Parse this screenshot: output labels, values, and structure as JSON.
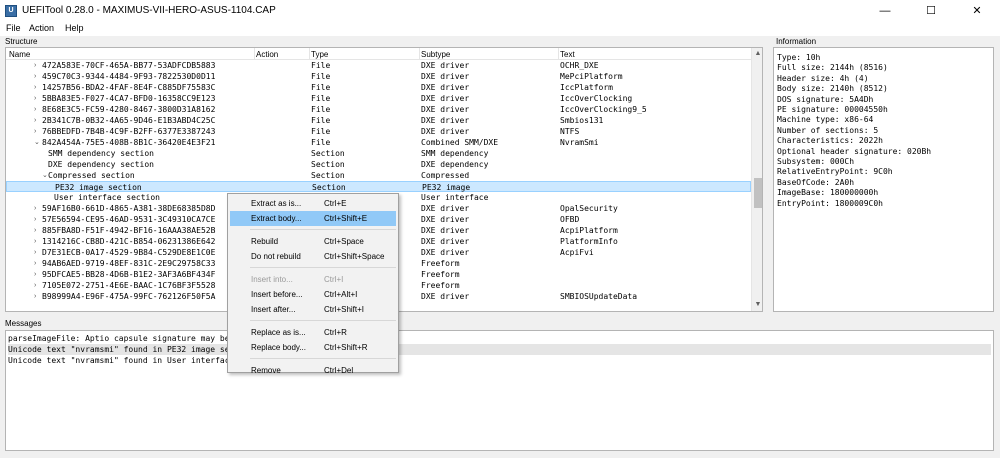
{
  "window": {
    "title": "UEFITool 0.28.0 - MAXIMUS-VII-HERO-ASUS-1104.CAP",
    "icon": "app-icon",
    "minimize": "—",
    "maximize": "☐",
    "close": "✕"
  },
  "menu": [
    "File",
    "Action",
    "Help"
  ],
  "structure": {
    "label": "Structure",
    "columns": [
      "Name",
      "Action",
      "Type",
      "Subtype",
      "Text"
    ],
    "rows": [
      {
        "arrow": "›",
        "name": "472A583E-70CF-465A-BB77-53ADFCDB5883",
        "action": "",
        "type": "File",
        "subtype": "DXE driver",
        "text": "OCHR_DXE"
      },
      {
        "arrow": "›",
        "name": "459C70C3-9344-4484-9F93-7822530D0D11",
        "action": "",
        "type": "File",
        "subtype": "DXE driver",
        "text": "MePciPlatform"
      },
      {
        "arrow": "›",
        "name": "14257B56-BDA2-4FAF-8E4F-C885DF75583C",
        "action": "",
        "type": "File",
        "subtype": "DXE driver",
        "text": "IccPlatform"
      },
      {
        "arrow": "›",
        "name": "5BBA83E5-F027-4CA7-BFD0-16358CC9E123",
        "action": "",
        "type": "File",
        "subtype": "DXE driver",
        "text": "IccOverClocking"
      },
      {
        "arrow": "›",
        "name": "8E68E3C5-FC59-4280-8467-3800D31A8162",
        "action": "",
        "type": "File",
        "subtype": "DXE driver",
        "text": "IccOverClocking9_5"
      },
      {
        "arrow": "›",
        "name": "2B341C7B-0B32-4A65-9D46-E1B3ABD4C25C",
        "action": "",
        "type": "File",
        "subtype": "DXE driver",
        "text": "Smbios131"
      },
      {
        "arrow": "›",
        "name": "76BBEDFD-7B4B-4C9F-B2FF-6377E3387243",
        "action": "",
        "type": "File",
        "subtype": "DXE driver",
        "text": "NTFS"
      },
      {
        "arrow": "⌄",
        "name": "842A454A-75E5-408B-8B1C-36420E4E3F21",
        "action": "",
        "type": "File",
        "subtype": "Combined SMM/DXE",
        "text": "NvramSmi"
      },
      {
        "arrow": "",
        "name": "SMM dependency section",
        "action": "",
        "type": "Section",
        "subtype": "SMM dependency",
        "text": ""
      },
      {
        "arrow": "",
        "name": "DXE dependency section",
        "action": "",
        "type": "Section",
        "subtype": "DXE dependency",
        "text": ""
      },
      {
        "arrow": "⌄",
        "name": "Compressed section",
        "action": "",
        "type": "Section",
        "subtype": "Compressed",
        "text": ""
      },
      {
        "arrow": "",
        "name": "PE32 image section",
        "action": "",
        "type": "Section",
        "subtype": "PE32 image",
        "text": ""
      },
      {
        "arrow": "",
        "name": "User interface section",
        "action": "",
        "type": "Section",
        "subtype": "User interface",
        "text": ""
      },
      {
        "arrow": "›",
        "name": "59AF16B0-661D-4865-A381-38DE68385D8D",
        "action": "",
        "type": "File",
        "subtype": "DXE driver",
        "text": "OpalSecurity"
      },
      {
        "arrow": "›",
        "name": "57E56594-CE95-46AD-9531-3C49310CA7CE",
        "action": "",
        "type": "File",
        "subtype": "DXE driver",
        "text": "OFBD"
      },
      {
        "arrow": "›",
        "name": "885FBA8D-F51F-4942-BF16-16AAA38AE52B",
        "action": "",
        "type": "File",
        "subtype": "DXE driver",
        "text": "AcpiPlatform"
      },
      {
        "arrow": "›",
        "name": "1314216C-CB8D-421C-B854-06231386E642",
        "action": "",
        "type": "File",
        "subtype": "DXE driver",
        "text": "PlatformInfo"
      },
      {
        "arrow": "›",
        "name": "D7E31ECB-0A17-4529-9B84-C529DE8E1C0E",
        "action": "",
        "type": "File",
        "subtype": "DXE driver",
        "text": "AcpiFvi"
      },
      {
        "arrow": "›",
        "name": "94AB6AED-9719-48EF-831C-2E9C29758C33",
        "action": "",
        "type": "File",
        "subtype": "Freeform",
        "text": ""
      },
      {
        "arrow": "›",
        "name": "95DFCAE5-BB28-4D6B-B1E2-3AF3A6BF434F",
        "action": "",
        "type": "File",
        "subtype": "Freeform",
        "text": ""
      },
      {
        "arrow": "›",
        "name": "7105E072-2751-4E6E-BAAC-1C76BF3F5528",
        "action": "",
        "type": "File",
        "subtype": "Freeform",
        "text": ""
      },
      {
        "arrow": "›",
        "name": "B98999A4-E96F-475A-99FC-762126F50F5A",
        "action": "",
        "type": "File",
        "subtype": "DXE driver",
        "text": "SMBIOSUpdateData"
      }
    ],
    "selected_row": 11,
    "scroll_up": "▲",
    "scroll_down": "▼"
  },
  "information": {
    "label": "Information",
    "lines": [
      "Type: 10h",
      "Full size: 2144h (8516)",
      "Header size: 4h (4)",
      "Body size: 2140h (8512)",
      "DOS signature: 5A4Dh",
      "PE signature: 00004550h",
      "Machine type: x86-64",
      "Number of sections: 5",
      "Characteristics: 2022h",
      "Optional header signature: 020Bh",
      "Subsystem: 000Ch",
      "RelativeEntryPoint: 9C0h",
      "BaseOfCode: 2A0h",
      "ImageBase: 180000000h",
      "EntryPoint: 1800009C0h"
    ]
  },
  "messages": {
    "label": "Messages",
    "lines": [
      "parseImageFile: Aptio capsule signature may be invalid",
      "Unicode text \"nvramsmi\" found in PE32 image section",
      "Unicode text \"nvramsmi\" found in User interface section"
    ],
    "highlighted": 1
  },
  "context_menu": {
    "items": [
      {
        "label": "Extract as is...",
        "shortcut": "Ctrl+E",
        "state": "normal"
      },
      {
        "label": "Extract body...",
        "shortcut": "Ctrl+Shift+E",
        "state": "hover"
      },
      {
        "sep": true
      },
      {
        "label": "Rebuild",
        "shortcut": "Ctrl+Space",
        "state": "normal"
      },
      {
        "label": "Do not rebuild",
        "shortcut": "Ctrl+Shift+Space",
        "state": "normal"
      },
      {
        "sep": true
      },
      {
        "label": "Insert into...",
        "shortcut": "Ctrl+I",
        "state": "disabled"
      },
      {
        "label": "Insert before...",
        "shortcut": "Ctrl+Alt+I",
        "state": "normal"
      },
      {
        "label": "Insert after...",
        "shortcut": "Ctrl+Shift+I",
        "state": "normal"
      },
      {
        "sep": true
      },
      {
        "label": "Replace as is...",
        "shortcut": "Ctrl+R",
        "state": "normal"
      },
      {
        "label": "Replace body...",
        "shortcut": "Ctrl+Shift+R",
        "state": "normal"
      },
      {
        "sep": true
      },
      {
        "label": "Remove",
        "shortcut": "Ctrl+Del",
        "state": "normal"
      }
    ]
  },
  "colors": {
    "selection": "#cce8ff",
    "menu_hover": "#91c9f7",
    "disabled_text": "#9a9a9a"
  }
}
